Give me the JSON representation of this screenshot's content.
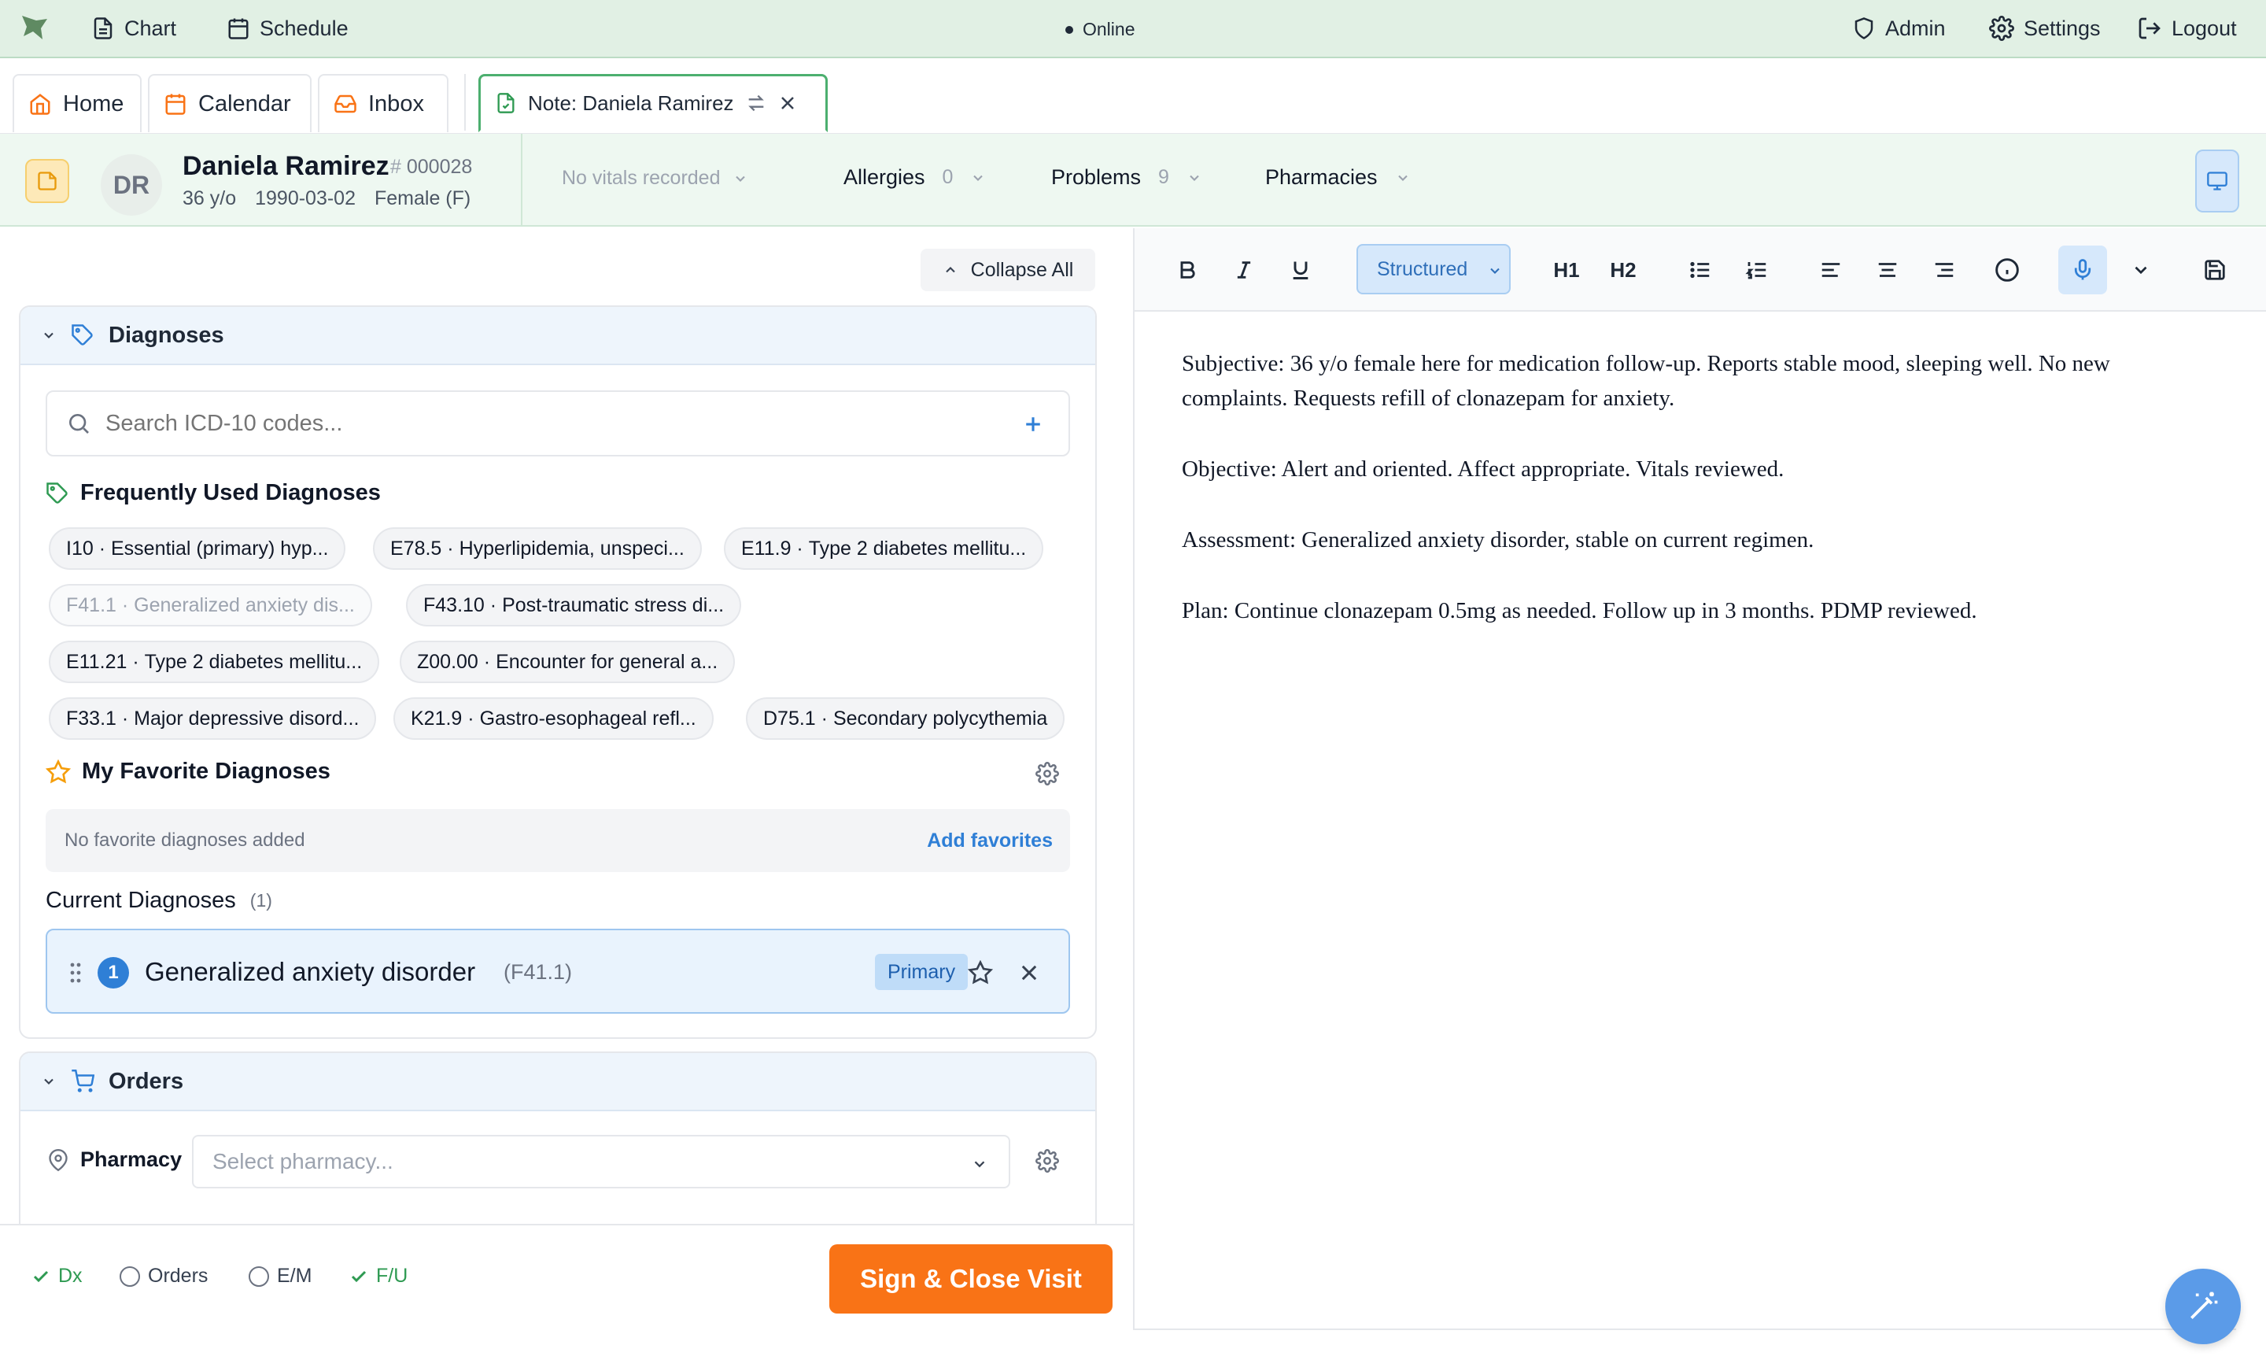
{
  "topbar": {
    "chart": "Chart",
    "schedule": "Schedule",
    "status": "Online",
    "admin": "Admin",
    "settings": "Settings",
    "logout": "Logout"
  },
  "tabs": [
    {
      "label": "Home"
    },
    {
      "label": "Calendar"
    },
    {
      "label": "Inbox"
    },
    {
      "label": "Note: Daniela Ramirez"
    }
  ],
  "patient": {
    "initials": "DR",
    "name": "Daniela Ramirez",
    "mrn": "000028",
    "age": "36 y/o",
    "dob": "1990-03-02",
    "sex": "Female (F)",
    "vitals": "No vitals recorded",
    "allergies_label": "Allergies",
    "allergies_count": "0",
    "problems_label": "Problems",
    "problems_count": "9",
    "pharmacies_label": "Pharmacies"
  },
  "left": {
    "collapse_all": "Collapse All",
    "diagnoses_title": "Diagnoses",
    "search_placeholder": "Search ICD-10 codes...",
    "frequent_title": "Frequently Used Diagnoses",
    "frequent": [
      {
        "code": "I10",
        "desc": "Essential (primary) hyp..."
      },
      {
        "code": "E78.5",
        "desc": "Hyperlipidemia, unspeci..."
      },
      {
        "code": "E11.9",
        "desc": "Type 2 diabetes mellitu..."
      },
      {
        "code": "F41.1",
        "desc": "Generalized anxiety dis..."
      },
      {
        "code": "F43.10",
        "desc": "Post-traumatic stress di..."
      },
      {
        "code": "E11.21",
        "desc": "Type 2 diabetes mellitu..."
      },
      {
        "code": "Z00.00",
        "desc": "Encounter for general a..."
      },
      {
        "code": "F33.1",
        "desc": "Major depressive disord..."
      },
      {
        "code": "K21.9",
        "desc": "Gastro-esophageal refl..."
      },
      {
        "code": "D75.1",
        "desc": "Secondary polycythemia"
      }
    ],
    "favorites_title": "My Favorite Diagnoses",
    "favorites_empty": "No favorite diagnoses added",
    "add_favorites": "Add favorites",
    "current_title": "Current Diagnoses",
    "current_count": "(1)",
    "current": [
      {
        "num": "1",
        "name": "Generalized anxiety disorder",
        "code": "(F41.1)",
        "badge": "Primary"
      }
    ],
    "orders_title": "Orders",
    "pharmacy_label": "Pharmacy",
    "pharmacy_placeholder": "Select pharmacy..."
  },
  "footer": {
    "dx": "Dx",
    "orders": "Orders",
    "em": "E/M",
    "fu": "F/U",
    "sign_button": "Sign & Close Visit"
  },
  "editor": {
    "mode": "Structured",
    "h1": "H1",
    "h2": "H2",
    "paragraphs": [
      "Subjective: 36 y/o female here for medication follow-up. Reports stable mood, sleeping well. No new complaints. Requests refill of clonazepam for anxiety.",
      "Objective: Alert and oriented. Affect appropriate. Vitals reviewed.",
      "Assessment: Generalized anxiety disorder, stable on current regimen.",
      "Plan: Continue clonazepam 0.5mg as needed. Follow up in 3 months. PDMP reviewed."
    ]
  },
  "colors": {
    "accent_green": "#4caf6f",
    "primary_blue": "#2f7fd6",
    "sign_orange": "#f97316",
    "fab_blue": "#5b9be8"
  }
}
